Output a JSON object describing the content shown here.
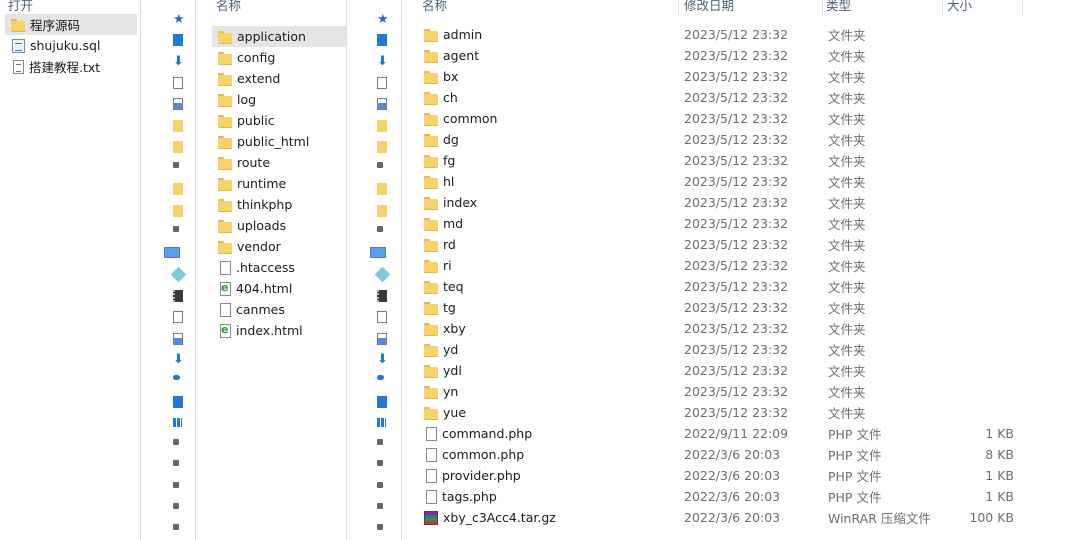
{
  "left_pane": {
    "header": "打开",
    "items": [
      {
        "name": "程序源码",
        "type": "folder",
        "selected": true
      },
      {
        "name": "shujuku.sql",
        "type": "sql"
      },
      {
        "name": "搭建教程.txt",
        "type": "txt"
      }
    ]
  },
  "middle_pane": {
    "header": "名称",
    "items": [
      {
        "name": "application",
        "type": "folder",
        "selected": true
      },
      {
        "name": "config",
        "type": "folder"
      },
      {
        "name": "extend",
        "type": "folder"
      },
      {
        "name": "log",
        "type": "folder"
      },
      {
        "name": "public",
        "type": "folder"
      },
      {
        "name": "public_html",
        "type": "folder"
      },
      {
        "name": "route",
        "type": "folder"
      },
      {
        "name": "runtime",
        "type": "folder"
      },
      {
        "name": "thinkphp",
        "type": "folder"
      },
      {
        "name": "uploads",
        "type": "folder"
      },
      {
        "name": "vendor",
        "type": "folder"
      },
      {
        "name": ".htaccess",
        "type": "file"
      },
      {
        "name": "404.html",
        "type": "html"
      },
      {
        "name": "canmes",
        "type": "file"
      },
      {
        "name": "index.html",
        "type": "html"
      }
    ]
  },
  "right_pane": {
    "columns": {
      "name": "名称",
      "date": "修改日期",
      "type": "类型",
      "size": "大小"
    },
    "rows": [
      {
        "name": "admin",
        "date": "2023/5/12 23:32",
        "type": "文件夹",
        "size": "",
        "icon": "folder"
      },
      {
        "name": "agent",
        "date": "2023/5/12 23:32",
        "type": "文件夹",
        "size": "",
        "icon": "folder"
      },
      {
        "name": "bx",
        "date": "2023/5/12 23:32",
        "type": "文件夹",
        "size": "",
        "icon": "folder"
      },
      {
        "name": "ch",
        "date": "2023/5/12 23:32",
        "type": "文件夹",
        "size": "",
        "icon": "folder"
      },
      {
        "name": "common",
        "date": "2023/5/12 23:32",
        "type": "文件夹",
        "size": "",
        "icon": "folder"
      },
      {
        "name": "dg",
        "date": "2023/5/12 23:32",
        "type": "文件夹",
        "size": "",
        "icon": "folder"
      },
      {
        "name": "fg",
        "date": "2023/5/12 23:32",
        "type": "文件夹",
        "size": "",
        "icon": "folder"
      },
      {
        "name": "hl",
        "date": "2023/5/12 23:32",
        "type": "文件夹",
        "size": "",
        "icon": "folder"
      },
      {
        "name": "index",
        "date": "2023/5/12 23:32",
        "type": "文件夹",
        "size": "",
        "icon": "folder"
      },
      {
        "name": "md",
        "date": "2023/5/12 23:32",
        "type": "文件夹",
        "size": "",
        "icon": "folder"
      },
      {
        "name": "rd",
        "date": "2023/5/12 23:32",
        "type": "文件夹",
        "size": "",
        "icon": "folder"
      },
      {
        "name": "ri",
        "date": "2023/5/12 23:32",
        "type": "文件夹",
        "size": "",
        "icon": "folder"
      },
      {
        "name": "teq",
        "date": "2023/5/12 23:32",
        "type": "文件夹",
        "size": "",
        "icon": "folder"
      },
      {
        "name": "tg",
        "date": "2023/5/12 23:32",
        "type": "文件夹",
        "size": "",
        "icon": "folder"
      },
      {
        "name": "xby",
        "date": "2023/5/12 23:32",
        "type": "文件夹",
        "size": "",
        "icon": "folder"
      },
      {
        "name": "yd",
        "date": "2023/5/12 23:32",
        "type": "文件夹",
        "size": "",
        "icon": "folder"
      },
      {
        "name": "ydl",
        "date": "2023/5/12 23:32",
        "type": "文件夹",
        "size": "",
        "icon": "folder"
      },
      {
        "name": "yn",
        "date": "2023/5/12 23:32",
        "type": "文件夹",
        "size": "",
        "icon": "folder"
      },
      {
        "name": "yue",
        "date": "2023/5/12 23:32",
        "type": "文件夹",
        "size": "",
        "icon": "folder"
      },
      {
        "name": "command.php",
        "date": "2022/9/11 22:09",
        "type": "PHP 文件",
        "size": "1 KB",
        "icon": "file"
      },
      {
        "name": "common.php",
        "date": "2022/3/6 20:03",
        "type": "PHP 文件",
        "size": "8 KB",
        "icon": "file"
      },
      {
        "name": "provider.php",
        "date": "2022/3/6 20:03",
        "type": "PHP 文件",
        "size": "1 KB",
        "icon": "file"
      },
      {
        "name": "tags.php",
        "date": "2022/3/6 20:03",
        "type": "PHP 文件",
        "size": "1 KB",
        "icon": "file"
      },
      {
        "name": "xby_c3Acc4.tar.gz",
        "date": "2022/3/6 20:03",
        "type": "WinRAR 压缩文件",
        "size": "100 KB",
        "icon": "rar"
      }
    ]
  },
  "nav_strip_icons": [
    "star-icon",
    "blue-tile-icon",
    "download-icon",
    "document-icon",
    "picture-icon",
    "folder-icon",
    "folder-icon",
    "drive-icon",
    "folder-icon",
    "folder-icon",
    "drive-icon",
    "this-pc-icon",
    "3d-objects-icon",
    "video-icon",
    "document-icon",
    "picture-icon",
    "download-icon",
    "music-icon",
    "desktop-icon",
    "windows-icon",
    "drive-icon",
    "drive-icon",
    "drive-icon",
    "drive-icon",
    "drive-icon"
  ]
}
